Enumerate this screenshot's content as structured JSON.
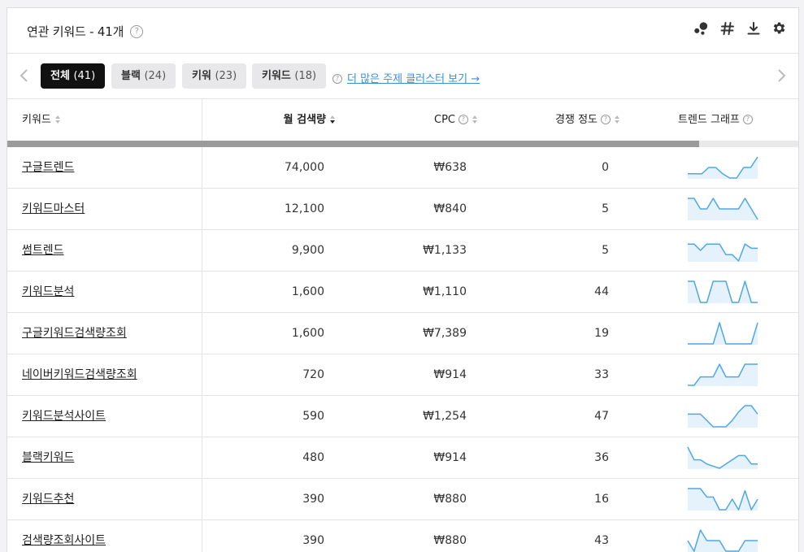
{
  "header": {
    "title": "연관 키워드 - 41개",
    "icons": [
      "cluster-icon",
      "hashtag-icon",
      "download-icon",
      "settings-icon"
    ]
  },
  "tabs": [
    {
      "label": "전체",
      "count": "(41)",
      "active": true
    },
    {
      "label": "블랙",
      "count": "(24)",
      "active": false
    },
    {
      "label": "키워",
      "count": "(23)",
      "active": false
    },
    {
      "label": "키워드",
      "count": "(18)",
      "active": false
    }
  ],
  "more_link": "더 많은 주제 클러스터 보기 →",
  "table": {
    "columns": {
      "keyword": "키워드",
      "volume": "월 검색량",
      "cpc": "CPC",
      "competition": "경쟁 정도",
      "trend": "트렌드 그래프"
    },
    "scroll_progress": 0.875,
    "rows": [
      {
        "keyword": "구글트렌드",
        "volume": "74,000",
        "cpc": "₩638",
        "competition": "0",
        "trend": [
          2,
          2,
          2,
          5,
          5,
          2,
          0,
          0,
          5,
          5,
          10
        ]
      },
      {
        "keyword": "키워드마스터",
        "volume": "12,100",
        "cpc": "₩840",
        "competition": "5",
        "trend": [
          10,
          10,
          5,
          5,
          10,
          5,
          5,
          5,
          5,
          10,
          5,
          0
        ]
      },
      {
        "keyword": "썸트렌드",
        "volume": "9,900",
        "cpc": "₩1,133",
        "competition": "5",
        "trend": [
          8,
          8,
          5,
          8,
          8,
          8,
          3,
          3,
          0,
          8,
          6,
          6
        ]
      },
      {
        "keyword": "키워드분석",
        "volume": "1,600",
        "cpc": "₩1,110",
        "competition": "44",
        "trend": [
          10,
          10,
          0,
          0,
          10,
          10,
          10,
          0,
          0,
          10,
          0,
          0
        ]
      },
      {
        "keyword": "구글키워드검색량조회",
        "volume": "1,600",
        "cpc": "₩7,389",
        "competition": "19",
        "trend": [
          0,
          0,
          0,
          0,
          0,
          10,
          0,
          0,
          0,
          0,
          0,
          10
        ]
      },
      {
        "keyword": "네이버키워드검색량조회",
        "volume": "720",
        "cpc": "₩914",
        "competition": "33",
        "trend": [
          0,
          0,
          4,
          4,
          4,
          10,
          4,
          4,
          4,
          10,
          10,
          10
        ]
      },
      {
        "keyword": "키워드분석사이트",
        "volume": "590",
        "cpc": "₩1,254",
        "competition": "47",
        "trend": [
          6,
          6,
          6,
          3,
          0,
          0,
          0,
          3,
          7,
          10,
          10,
          6
        ]
      },
      {
        "keyword": "블랙키워드",
        "volume": "480",
        "cpc": "₩914",
        "competition": "36",
        "trend": [
          10,
          4,
          4,
          2,
          1,
          0,
          2,
          4,
          6,
          6,
          2,
          2
        ]
      },
      {
        "keyword": "키워드추천",
        "volume": "390",
        "cpc": "₩880",
        "competition": "16",
        "trend": [
          10,
          10,
          10,
          6,
          6,
          0,
          0,
          5,
          0,
          9,
          0,
          5
        ]
      },
      {
        "keyword": "검색량조회사이트",
        "volume": "390",
        "cpc": "₩880",
        "competition": "43",
        "trend": [
          5,
          0,
          10,
          5,
          5,
          5,
          0,
          0,
          0,
          5,
          5,
          5
        ]
      }
    ]
  },
  "colors": {
    "accent_link": "#3b8fd9",
    "sparkline": "#4ea7e6",
    "sparkline_fill": "#e6f2fb",
    "active_tab": "#111111"
  }
}
